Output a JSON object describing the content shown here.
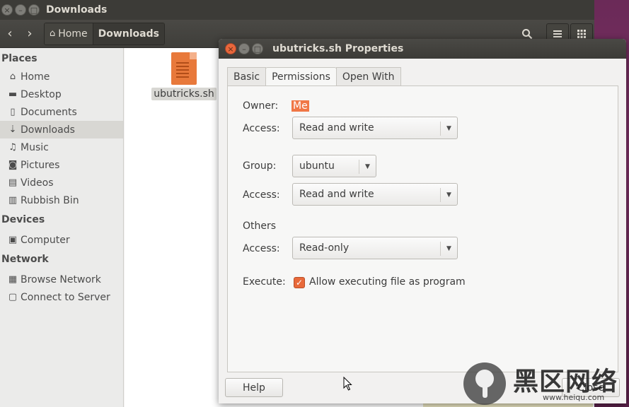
{
  "nautilus": {
    "title": "Downloads",
    "breadcrumb": [
      {
        "label": "Home",
        "icon": "home-icon"
      },
      {
        "label": "Downloads",
        "active": true
      }
    ],
    "sidebar": {
      "sections": [
        {
          "heading": "Places",
          "items": [
            {
              "label": "Home",
              "icon": "home-icon"
            },
            {
              "label": "Desktop",
              "icon": "folder-icon"
            },
            {
              "label": "Documents",
              "icon": "document-icon"
            },
            {
              "label": "Downloads",
              "icon": "download-icon",
              "selected": true
            },
            {
              "label": "Music",
              "icon": "music-icon"
            },
            {
              "label": "Pictures",
              "icon": "camera-icon"
            },
            {
              "label": "Videos",
              "icon": "film-icon"
            },
            {
              "label": "Rubbish Bin",
              "icon": "trash-icon"
            }
          ]
        },
        {
          "heading": "Devices",
          "items": [
            {
              "label": "Computer",
              "icon": "drive-icon"
            }
          ]
        },
        {
          "heading": "Network",
          "items": [
            {
              "label": "Browse Network",
              "icon": "network-icon"
            },
            {
              "label": "Connect to Server",
              "icon": "server-icon"
            }
          ]
        }
      ]
    },
    "files": [
      {
        "name": "ubutricks.sh",
        "icon": "shell-script-icon",
        "selected": true
      }
    ]
  },
  "dialog": {
    "title": "ubutricks.sh Properties",
    "tabs": [
      {
        "label": "Basic"
      },
      {
        "label": "Permissions",
        "active": true
      },
      {
        "label": "Open With"
      }
    ],
    "permissions": {
      "owner_label": "Owner:",
      "owner_value": "Me",
      "owner_access_label": "Access:",
      "owner_access": "Read and write",
      "group_label": "Group:",
      "group_value": "ubuntu",
      "group_access_label": "Access:",
      "group_access": "Read and write",
      "others_label": "Others",
      "others_access_label": "Access:",
      "others_access": "Read-only",
      "execute_label": "Execute:",
      "execute_checkbox_label": "Allow executing file as program",
      "execute_checked": true
    },
    "help_button": "Help",
    "close_button": "Close"
  },
  "watermark": {
    "brand": "黑区网络",
    "url": "www.heiqu.com"
  },
  "colors": {
    "accent": "#f07746",
    "titlebar": "#3c3b37",
    "sidebar_bg": "#ebebea",
    "dialog_bg": "#f2f1f0"
  }
}
